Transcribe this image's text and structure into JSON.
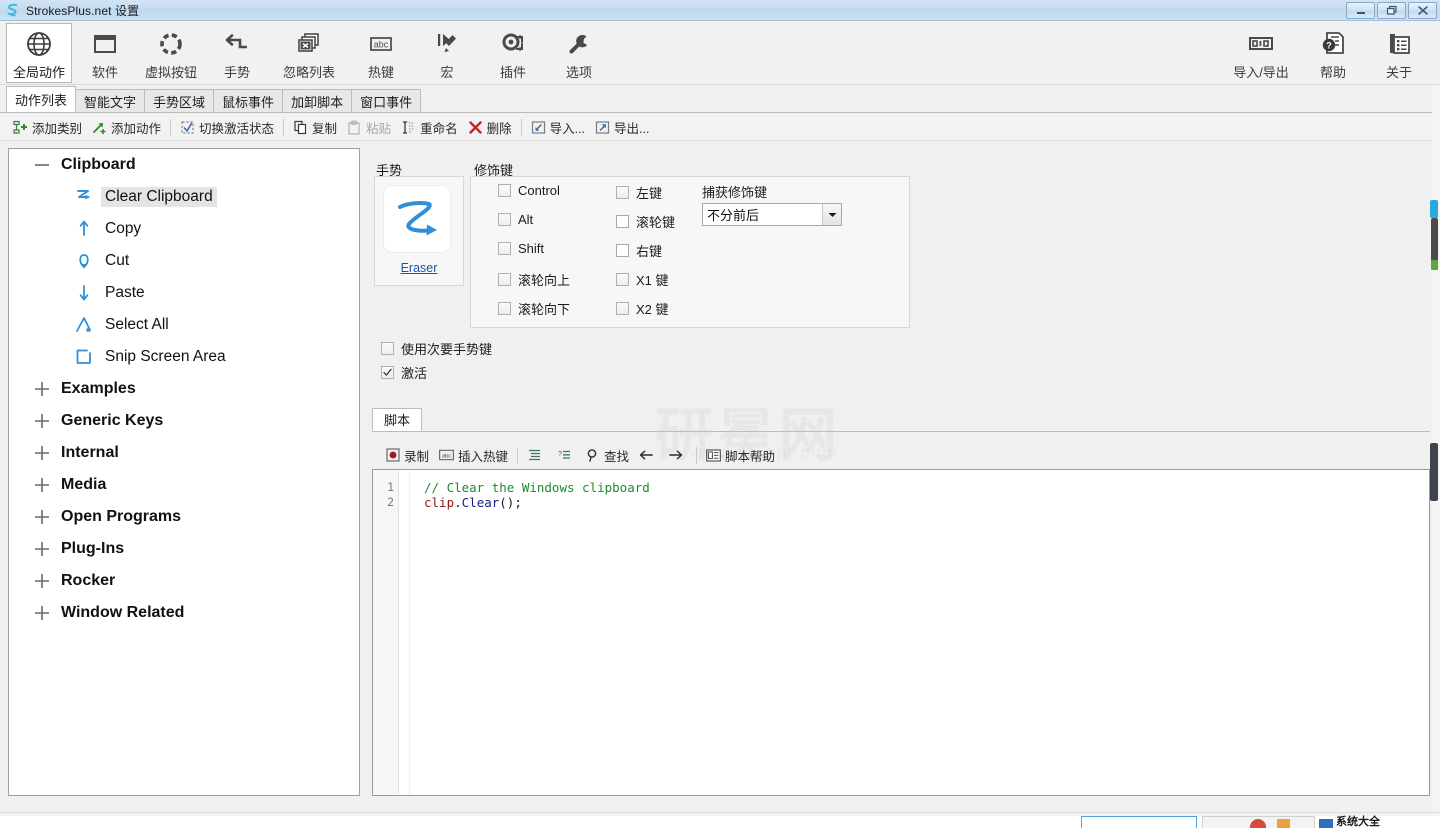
{
  "window": {
    "title": "StrokesPlus.net 设置",
    "app_icon": "strokesplus-s-icon",
    "controls": {
      "minimize": "minimize-icon",
      "restore": "restore-icon",
      "close": "close-icon"
    }
  },
  "ribbon": {
    "left_items": [
      {
        "label": "全局动作",
        "icon": "globe-icon",
        "selected": true
      },
      {
        "label": "软件",
        "icon": "window-icon",
        "selected": false
      },
      {
        "label": "虚拟按钮",
        "icon": "dotted-circle-icon",
        "selected": false
      },
      {
        "label": "手势",
        "icon": "gesture-arrow-icon",
        "selected": false
      },
      {
        "label": "忽略列表",
        "icon": "stacked-x-windows-icon",
        "selected": false
      },
      {
        "label": "热键",
        "icon": "abc-key-icon",
        "selected": false
      },
      {
        "label": "宏",
        "icon": "macro-play-icon",
        "selected": false
      },
      {
        "label": "插件",
        "icon": "plugin-gear-icon",
        "selected": false
      },
      {
        "label": "选项",
        "icon": "wrench-icon",
        "selected": false
      }
    ],
    "right_items": [
      {
        "label": "导入/导出",
        "icon": "import-export-icon"
      },
      {
        "label": "帮助",
        "icon": "help-question-doc-icon"
      },
      {
        "label": "关于",
        "icon": "about-info-icon"
      }
    ]
  },
  "tabs": [
    {
      "label": "动作列表",
      "active": true
    },
    {
      "label": "智能文字",
      "active": false
    },
    {
      "label": "手势区域",
      "active": false
    },
    {
      "label": "鼠标事件",
      "active": false
    },
    {
      "label": "加卸脚本",
      "active": false
    },
    {
      "label": "窗口事件",
      "active": false
    }
  ],
  "action_toolbar": [
    {
      "label": "添加类别",
      "icon": "add-category-icon",
      "disabled": false
    },
    {
      "label": "添加动作",
      "icon": "add-action-arrow-icon",
      "disabled": false
    },
    {
      "sep": true
    },
    {
      "label": "切换激活状态",
      "icon": "toggle-active-icon",
      "disabled": false
    },
    {
      "sep": true
    },
    {
      "label": "复制",
      "icon": "copy-icon",
      "disabled": false
    },
    {
      "label": "粘贴",
      "icon": "paste-icon",
      "disabled": true
    },
    {
      "label": "重命名",
      "icon": "rename-cursor-icon",
      "disabled": false
    },
    {
      "label": "删除",
      "icon": "delete-x-icon",
      "disabled": false
    },
    {
      "sep": true
    },
    {
      "label": "导入...",
      "icon": "import-arrow-icon",
      "disabled": false
    },
    {
      "label": "导出...",
      "icon": "export-arrow-icon",
      "disabled": false
    }
  ],
  "tree": [
    {
      "label": "Clipboard",
      "type": "group",
      "expanded": true,
      "expander": "minus-icon",
      "children": [
        {
          "label": "Clear Clipboard",
          "icon": "gesture-zigzag-icon",
          "selected": true
        },
        {
          "label": "Copy",
          "icon": "gesture-up-arrow-icon",
          "selected": false
        },
        {
          "label": "Cut",
          "icon": "gesture-loop-down-icon",
          "selected": false
        },
        {
          "label": "Paste",
          "icon": "gesture-down-arrow-icon",
          "selected": false
        },
        {
          "label": "Select All",
          "icon": "gesture-caret-icon",
          "selected": false
        },
        {
          "label": "Snip Screen Area",
          "icon": "gesture-rect-icon",
          "selected": false
        }
      ]
    },
    {
      "label": "Examples",
      "type": "group",
      "expanded": false,
      "expander": "plus-icon",
      "children": []
    },
    {
      "label": "Generic Keys",
      "type": "group",
      "expanded": false,
      "expander": "plus-icon",
      "children": []
    },
    {
      "label": "Internal",
      "type": "group",
      "expanded": false,
      "expander": "plus-icon",
      "children": []
    },
    {
      "label": "Media",
      "type": "group",
      "expanded": false,
      "expander": "plus-icon",
      "children": []
    },
    {
      "label": "Open Programs",
      "type": "group",
      "expanded": false,
      "expander": "plus-icon",
      "children": []
    },
    {
      "label": "Plug-Ins",
      "type": "group",
      "expanded": false,
      "expander": "plus-icon",
      "children": []
    },
    {
      "label": "Rocker",
      "type": "group",
      "expanded": false,
      "expander": "plus-icon",
      "children": []
    },
    {
      "label": "Window Related",
      "type": "group",
      "expanded": false,
      "expander": "plus-icon",
      "children": []
    }
  ],
  "gesture": {
    "group_title": "手势",
    "preview_icon": "gesture-zigzag-large-icon",
    "name": "Eraser"
  },
  "modifiers": {
    "group_title": "修饰键",
    "column1": [
      {
        "label": "Control",
        "checked": false
      },
      {
        "label": "Alt",
        "checked": false
      },
      {
        "label": "Shift",
        "checked": false
      },
      {
        "label": "滚轮向上",
        "checked": false
      },
      {
        "label": "滚轮向下",
        "checked": false
      }
    ],
    "column2": [
      {
        "label": "左键",
        "checked": false
      },
      {
        "label": "滚轮键",
        "checked": false
      },
      {
        "label": "右键",
        "checked": false
      },
      {
        "label": "X1 键",
        "checked": false
      },
      {
        "label": "X2 键",
        "checked": false
      }
    ],
    "capture_label": "捕获修饰键",
    "capture_value": "不分前后"
  },
  "options": [
    {
      "label": "使用次要手势键",
      "checked": false
    },
    {
      "label": "激活",
      "checked": true
    }
  ],
  "script": {
    "tab_label": "脚本",
    "toolbar": [
      {
        "label": "录制",
        "icon": "record-dot-icon"
      },
      {
        "label": "插入热键",
        "icon": "abc-key-icon"
      },
      {
        "sep": true
      },
      {
        "label": "",
        "icon": "indent-list-icon"
      },
      {
        "label": "",
        "icon": "intellisense-icon"
      },
      {
        "label": "查找",
        "icon": "search-magnifier-icon"
      },
      {
        "label": "",
        "icon": "arrow-left-icon"
      },
      {
        "label": "",
        "icon": "arrow-right-icon"
      },
      {
        "sep": true
      },
      {
        "label": "脚本帮助",
        "icon": "script-help-icon"
      }
    ],
    "lines": [
      {
        "num": "1",
        "tokens": [
          {
            "t": "// Clear the Windows clipboard",
            "c": "comment"
          }
        ]
      },
      {
        "num": "2",
        "tokens": [
          {
            "t": "clip",
            "c": "id"
          },
          {
            "t": ".",
            "c": "plain"
          },
          {
            "t": "Clear",
            "c": "method"
          },
          {
            "t": "();",
            "c": "plain"
          }
        ]
      }
    ]
  },
  "watermark": {
    "text": "研冕网",
    "sub": "www.yanmi.com"
  },
  "colors": {
    "accent": "#1757a8",
    "gesture_blue": "#2f8fd8",
    "titlebar": "#c4dcf0",
    "selected_row": "#e4e4e4",
    "comment_green": "#1d8a2e",
    "identifier_red": "#8b1a1a"
  }
}
